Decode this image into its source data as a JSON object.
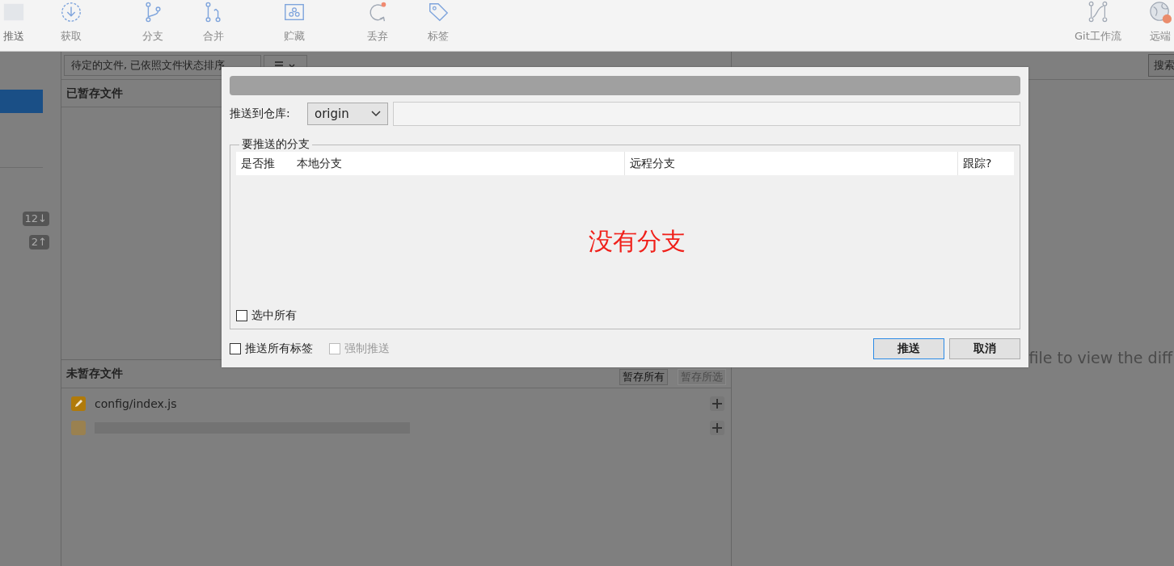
{
  "toolbar": {
    "items": [
      {
        "label": "推送"
      },
      {
        "label": "获取"
      },
      {
        "label": "分支"
      },
      {
        "label": "合并"
      },
      {
        "label": "贮藏"
      },
      {
        "label": "丢弃"
      },
      {
        "label": "标签"
      },
      {
        "label": "Git工作流"
      },
      {
        "label": "远端"
      }
    ]
  },
  "sidebar": {
    "badges": [
      {
        "label": "12↓"
      },
      {
        "label": "2↑"
      }
    ]
  },
  "file_panel": {
    "sort_dropdown": "待定的文件, 已依照文件状态排序",
    "staged_header": "已暂存文件",
    "unstaged_header": "未暂存文件",
    "buttons": [
      {
        "label": "暂存所有",
        "disabled": false
      },
      {
        "label": "暂存所选",
        "disabled": true
      }
    ],
    "files": [
      {
        "kind": "file",
        "name": "config/index.js"
      },
      {
        "kind": "redacted"
      }
    ]
  },
  "search_button": "搜索",
  "diff_hint": "file to view the diff",
  "dialog": {
    "repo_label": "推送到仓库:",
    "repo_select": "origin",
    "group_title": "要推送的分支",
    "columns": [
      "是否推",
      "本地分支",
      "远程分支",
      "跟踪?"
    ],
    "empty_note": "没有分支",
    "checkboxes": [
      {
        "label": "选中所有",
        "checked": false,
        "disabled": false
      },
      {
        "label": "推送所有标签",
        "checked": false,
        "disabled": false
      },
      {
        "label": "强制推送",
        "checked": false,
        "disabled": true
      }
    ],
    "buttons": [
      {
        "label": "推送",
        "default": true
      },
      {
        "label": "取消",
        "default": false
      }
    ]
  }
}
